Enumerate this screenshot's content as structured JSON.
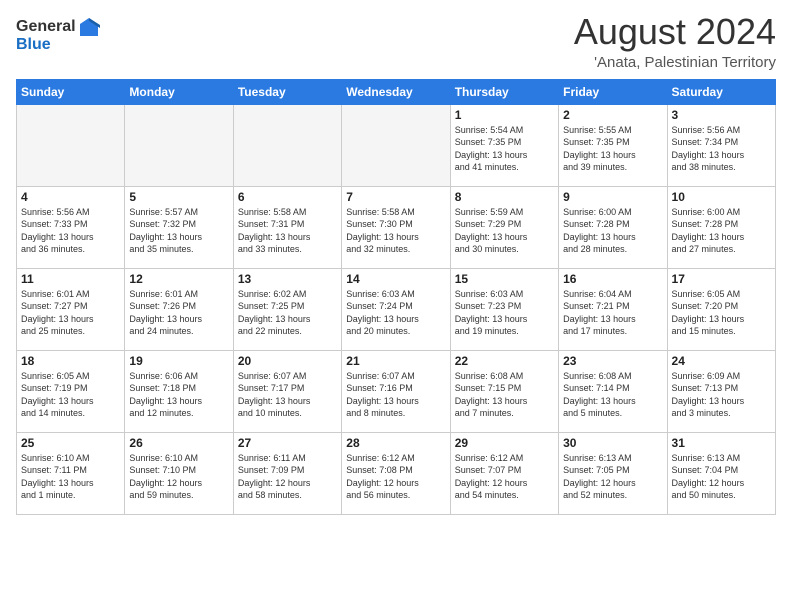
{
  "logo": {
    "general": "General",
    "blue": "Blue"
  },
  "header": {
    "month_year": "August 2024",
    "location": "'Anata, Palestinian Territory"
  },
  "columns": [
    "Sunday",
    "Monday",
    "Tuesday",
    "Wednesday",
    "Thursday",
    "Friday",
    "Saturday"
  ],
  "weeks": [
    [
      {
        "day": "",
        "info": ""
      },
      {
        "day": "",
        "info": ""
      },
      {
        "day": "",
        "info": ""
      },
      {
        "day": "",
        "info": ""
      },
      {
        "day": "1",
        "info": "Sunrise: 5:54 AM\nSunset: 7:35 PM\nDaylight: 13 hours\nand 41 minutes."
      },
      {
        "day": "2",
        "info": "Sunrise: 5:55 AM\nSunset: 7:35 PM\nDaylight: 13 hours\nand 39 minutes."
      },
      {
        "day": "3",
        "info": "Sunrise: 5:56 AM\nSunset: 7:34 PM\nDaylight: 13 hours\nand 38 minutes."
      }
    ],
    [
      {
        "day": "4",
        "info": "Sunrise: 5:56 AM\nSunset: 7:33 PM\nDaylight: 13 hours\nand 36 minutes."
      },
      {
        "day": "5",
        "info": "Sunrise: 5:57 AM\nSunset: 7:32 PM\nDaylight: 13 hours\nand 35 minutes."
      },
      {
        "day": "6",
        "info": "Sunrise: 5:58 AM\nSunset: 7:31 PM\nDaylight: 13 hours\nand 33 minutes."
      },
      {
        "day": "7",
        "info": "Sunrise: 5:58 AM\nSunset: 7:30 PM\nDaylight: 13 hours\nand 32 minutes."
      },
      {
        "day": "8",
        "info": "Sunrise: 5:59 AM\nSunset: 7:29 PM\nDaylight: 13 hours\nand 30 minutes."
      },
      {
        "day": "9",
        "info": "Sunrise: 6:00 AM\nSunset: 7:28 PM\nDaylight: 13 hours\nand 28 minutes."
      },
      {
        "day": "10",
        "info": "Sunrise: 6:00 AM\nSunset: 7:28 PM\nDaylight: 13 hours\nand 27 minutes."
      }
    ],
    [
      {
        "day": "11",
        "info": "Sunrise: 6:01 AM\nSunset: 7:27 PM\nDaylight: 13 hours\nand 25 minutes."
      },
      {
        "day": "12",
        "info": "Sunrise: 6:01 AM\nSunset: 7:26 PM\nDaylight: 13 hours\nand 24 minutes."
      },
      {
        "day": "13",
        "info": "Sunrise: 6:02 AM\nSunset: 7:25 PM\nDaylight: 13 hours\nand 22 minutes."
      },
      {
        "day": "14",
        "info": "Sunrise: 6:03 AM\nSunset: 7:24 PM\nDaylight: 13 hours\nand 20 minutes."
      },
      {
        "day": "15",
        "info": "Sunrise: 6:03 AM\nSunset: 7:23 PM\nDaylight: 13 hours\nand 19 minutes."
      },
      {
        "day": "16",
        "info": "Sunrise: 6:04 AM\nSunset: 7:21 PM\nDaylight: 13 hours\nand 17 minutes."
      },
      {
        "day": "17",
        "info": "Sunrise: 6:05 AM\nSunset: 7:20 PM\nDaylight: 13 hours\nand 15 minutes."
      }
    ],
    [
      {
        "day": "18",
        "info": "Sunrise: 6:05 AM\nSunset: 7:19 PM\nDaylight: 13 hours\nand 14 minutes."
      },
      {
        "day": "19",
        "info": "Sunrise: 6:06 AM\nSunset: 7:18 PM\nDaylight: 13 hours\nand 12 minutes."
      },
      {
        "day": "20",
        "info": "Sunrise: 6:07 AM\nSunset: 7:17 PM\nDaylight: 13 hours\nand 10 minutes."
      },
      {
        "day": "21",
        "info": "Sunrise: 6:07 AM\nSunset: 7:16 PM\nDaylight: 13 hours\nand 8 minutes."
      },
      {
        "day": "22",
        "info": "Sunrise: 6:08 AM\nSunset: 7:15 PM\nDaylight: 13 hours\nand 7 minutes."
      },
      {
        "day": "23",
        "info": "Sunrise: 6:08 AM\nSunset: 7:14 PM\nDaylight: 13 hours\nand 5 minutes."
      },
      {
        "day": "24",
        "info": "Sunrise: 6:09 AM\nSunset: 7:13 PM\nDaylight: 13 hours\nand 3 minutes."
      }
    ],
    [
      {
        "day": "25",
        "info": "Sunrise: 6:10 AM\nSunset: 7:11 PM\nDaylight: 13 hours\nand 1 minute."
      },
      {
        "day": "26",
        "info": "Sunrise: 6:10 AM\nSunset: 7:10 PM\nDaylight: 12 hours\nand 59 minutes."
      },
      {
        "day": "27",
        "info": "Sunrise: 6:11 AM\nSunset: 7:09 PM\nDaylight: 12 hours\nand 58 minutes."
      },
      {
        "day": "28",
        "info": "Sunrise: 6:12 AM\nSunset: 7:08 PM\nDaylight: 12 hours\nand 56 minutes."
      },
      {
        "day": "29",
        "info": "Sunrise: 6:12 AM\nSunset: 7:07 PM\nDaylight: 12 hours\nand 54 minutes."
      },
      {
        "day": "30",
        "info": "Sunrise: 6:13 AM\nSunset: 7:05 PM\nDaylight: 12 hours\nand 52 minutes."
      },
      {
        "day": "31",
        "info": "Sunrise: 6:13 AM\nSunset: 7:04 PM\nDaylight: 12 hours\nand 50 minutes."
      }
    ]
  ]
}
